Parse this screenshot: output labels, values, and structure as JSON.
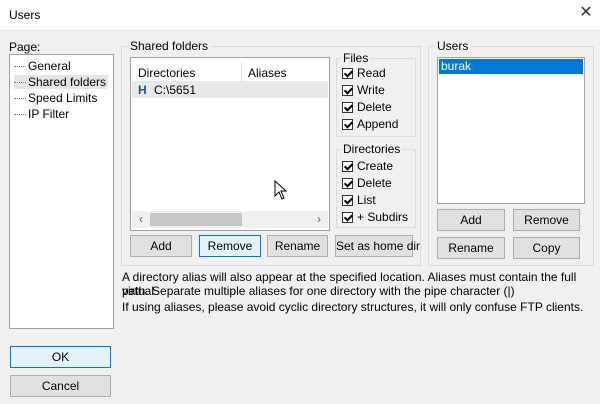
{
  "window": {
    "title": "Users",
    "close_glyph": "✕"
  },
  "page_panel": {
    "label": "Page:",
    "items": [
      {
        "label": "General"
      },
      {
        "label": "Shared folders",
        "selected": true
      },
      {
        "label": "Speed Limits"
      },
      {
        "label": "IP Filter"
      }
    ]
  },
  "shared_folders": {
    "group_label": "Shared folders",
    "columns": [
      "Directories",
      "Aliases"
    ],
    "rows": [
      {
        "flag": "H",
        "directory": "C:\\5651",
        "alias": ""
      }
    ],
    "scroll_left": "‹",
    "scroll_right": "›",
    "buttons": {
      "add": "Add",
      "remove": "Remove",
      "rename": "Rename",
      "set_home": "Set as home dir"
    }
  },
  "files_group": {
    "label": "Files",
    "options": [
      {
        "label": "Read",
        "checked": true
      },
      {
        "label": "Write",
        "checked": true
      },
      {
        "label": "Delete",
        "checked": true
      },
      {
        "label": "Append",
        "checked": true
      }
    ]
  },
  "dirs_group": {
    "label": "Directories",
    "options": [
      {
        "label": "Create",
        "checked": true
      },
      {
        "label": "Delete",
        "checked": true
      },
      {
        "label": "List",
        "checked": true
      },
      {
        "label": "+ Subdirs",
        "checked": true
      }
    ]
  },
  "users_group": {
    "label": "Users",
    "users": [
      {
        "name": "burak",
        "selected": true
      }
    ],
    "buttons": {
      "add": "Add",
      "remove": "Remove",
      "rename": "Rename",
      "copy": "Copy"
    }
  },
  "info": {
    "line1": "A directory alias will also appear at the specified location. Aliases must contain the full virtual",
    "line2": "path. Separate multiple aliases for one directory with the pipe character (|)",
    "line3": "If using aliases, please avoid cyclic directory structures, it will only confuse FTP clients."
  },
  "dialog_buttons": {
    "ok": "OK",
    "cancel": "Cancel"
  },
  "colors": {
    "selection": "#0078d7",
    "focus_border": "#0078d7"
  }
}
